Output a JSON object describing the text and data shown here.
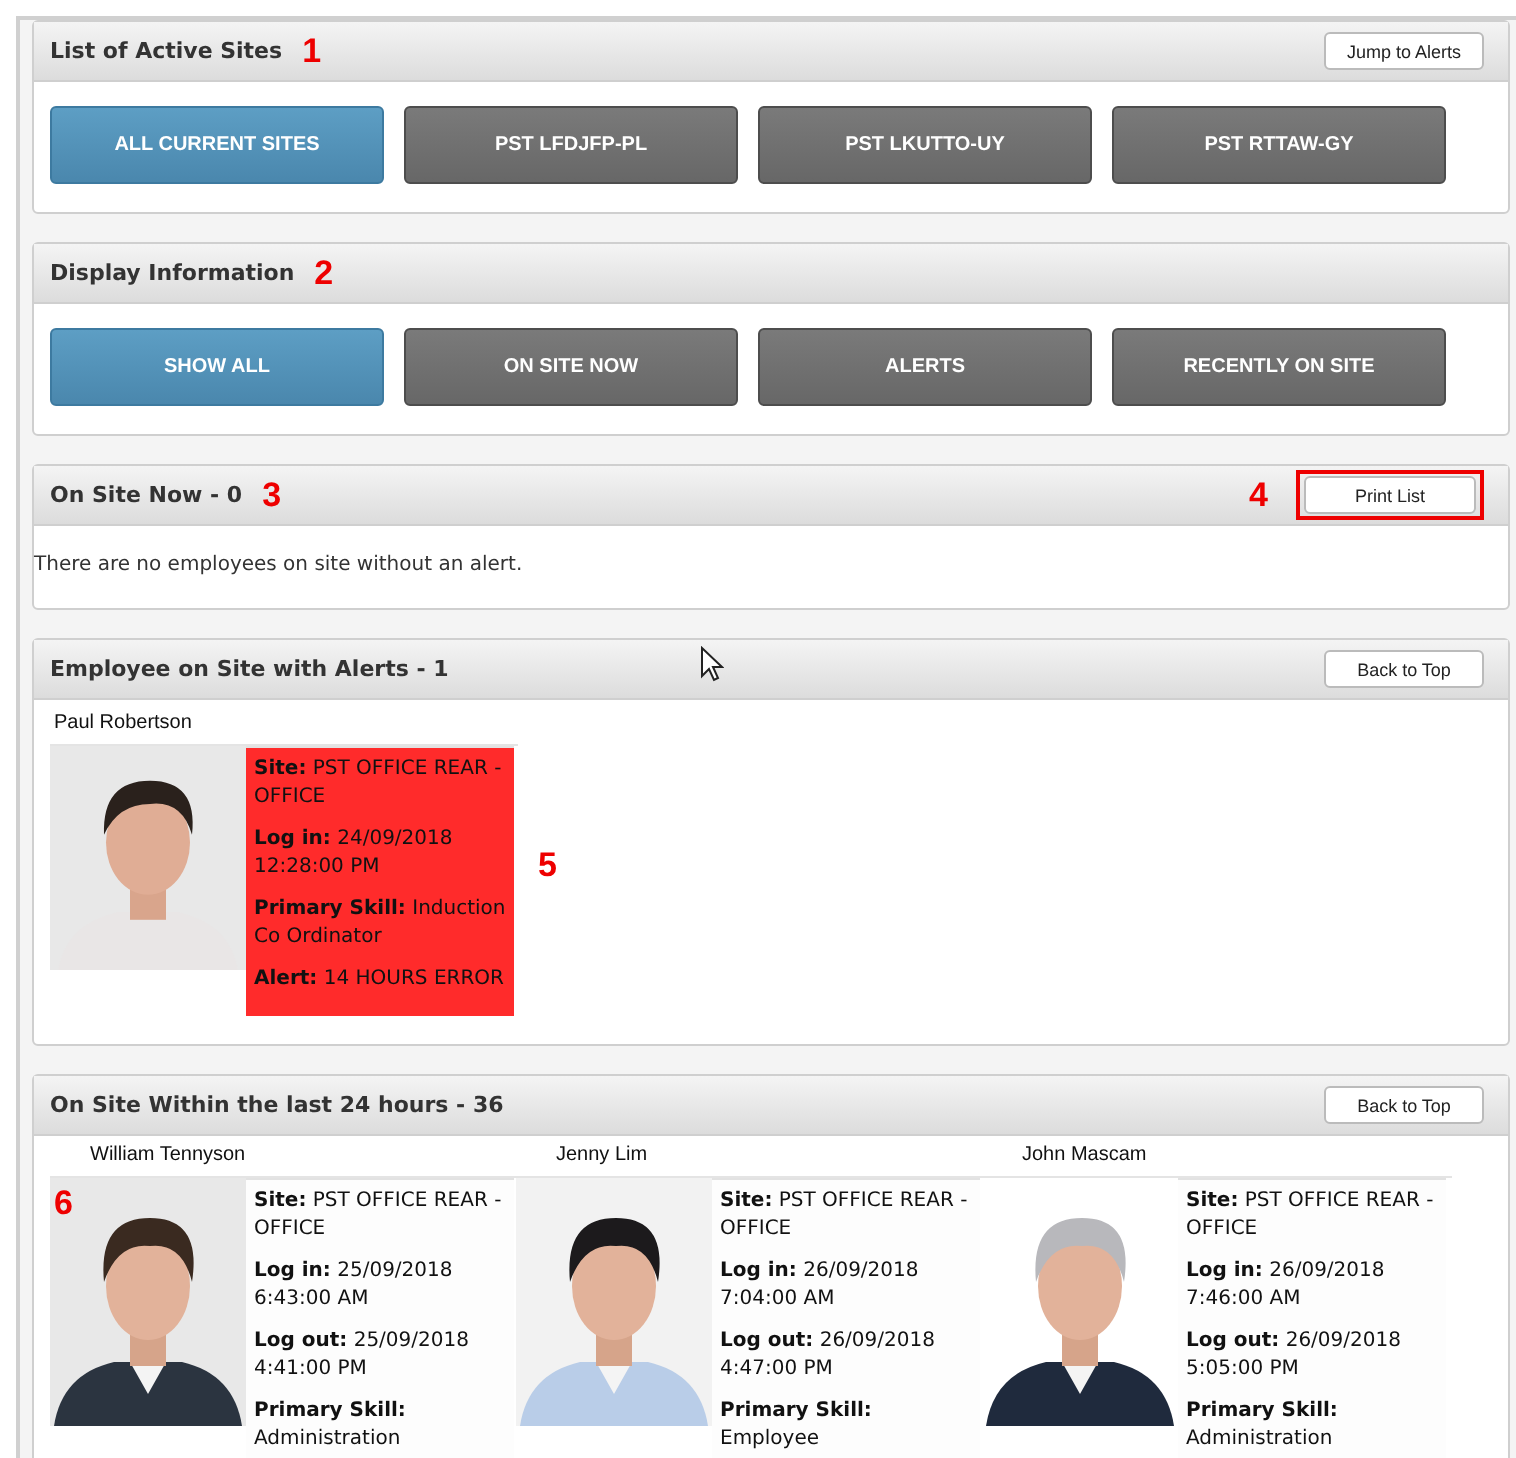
{
  "sites_panel": {
    "title": "List of Active Sites",
    "annotation": "1",
    "action": "Jump to Alerts",
    "buttons": [
      {
        "label": "ALL CURRENT SITES",
        "selected": true
      },
      {
        "label": "PST LFDJFP-PL",
        "selected": false
      },
      {
        "label": "PST LKUTTO-UY",
        "selected": false
      },
      {
        "label": "PST RTTAW-GY",
        "selected": false
      }
    ]
  },
  "display_panel": {
    "title": "Display Information",
    "annotation": "2",
    "buttons": [
      {
        "label": "SHOW ALL",
        "selected": true
      },
      {
        "label": "ON SITE NOW",
        "selected": false
      },
      {
        "label": "ALERTS",
        "selected": false
      },
      {
        "label": "RECENTLY ON SITE",
        "selected": false
      }
    ]
  },
  "on_site_panel": {
    "title": "On Site Now - 0",
    "annotation": "3",
    "action_annotation": "4",
    "action": "Print List",
    "message": "There are no employees on site without an alert."
  },
  "alerts_panel": {
    "title": "Employee on Site with Alerts - 1",
    "annotation": "5",
    "action": "Back to Top",
    "employees": [
      {
        "name": "Paul Robertson",
        "alert": true,
        "details": [
          "**Site:** PST OFFICE REAR - OFFICE",
          "**Log in:** 24/09/2018 12:28:00 PM",
          "**Primary Skill:** Induction Co Ordinator",
          "**Alert:** 14 HOURS ERROR"
        ]
      }
    ]
  },
  "recent_panel": {
    "title": "On Site Within the last 24 hours - 36",
    "annotation": "6",
    "action": "Back to Top",
    "employees": [
      {
        "name": "William Tennyson",
        "alert": false,
        "details": [
          "**Site:** PST OFFICE REAR - OFFICE",
          "**Log in:** 25/09/2018 6:43:00 AM",
          "**Log out:** 25/09/2018 4:41:00 PM",
          "**Primary Skill:** Administration"
        ]
      },
      {
        "name": "Jenny Lim",
        "alert": false,
        "details": [
          "**Site:** PST OFFICE REAR - OFFICE",
          "**Log in:** 26/09/2018 7:04:00 AM",
          "**Log out:** 26/09/2018 4:47:00 PM",
          "**Primary Skill:** Employee"
        ]
      },
      {
        "name": "John Mascam",
        "alert": false,
        "details": [
          "**Site:** PST OFFICE REAR - OFFICE",
          "**Log in:** 26/09/2018 7:46:00 AM",
          "**Log out:** 26/09/2018 5:05:00 PM",
          "**Primary Skill:** Administration"
        ]
      }
    ]
  }
}
